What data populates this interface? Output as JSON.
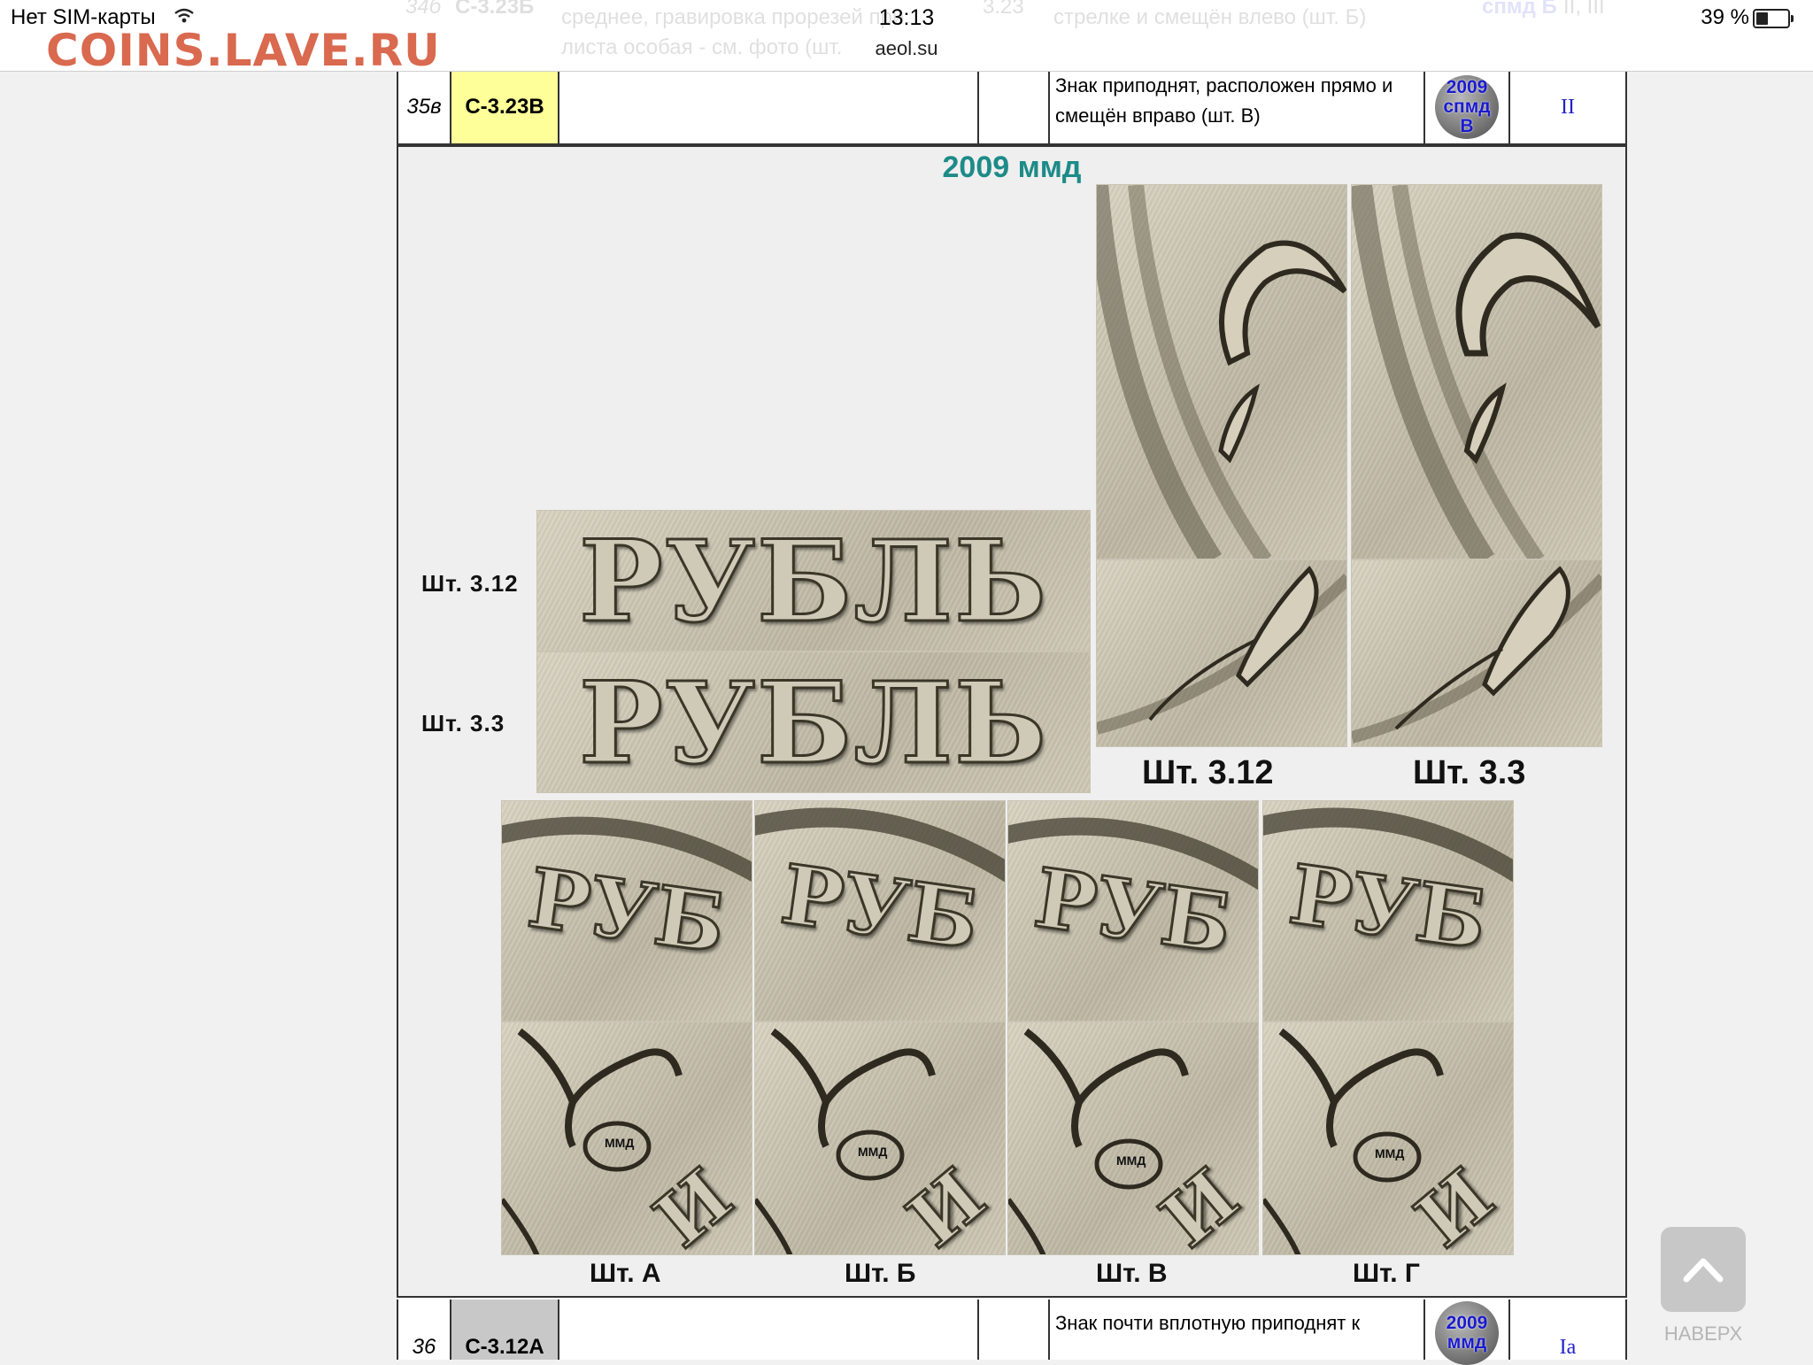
{
  "status_bar": {
    "carrier": "Нет SIM-карты",
    "time": "13:13",
    "url": "aeol.su",
    "battery": "39 %",
    "battery_level": 0.39
  },
  "watermark": "COINS.LAVE.RU",
  "faded_row": {
    "num": "34б",
    "code": "С-3.23Б",
    "desc1": "среднее, гравировка прорезей при",
    "desc2": "листа особая - см. фото (шт.",
    "code2": "3.23",
    "desc3": "стрелке и смещён влево (шт. Б)",
    "year": "спмд Б",
    "grade": "II, III"
  },
  "row_35v": {
    "num": "35в",
    "code": "С-3.23В",
    "desc": "Знак приподнят, расположен прямо и смещён вправо (шт. В)",
    "year_top": "2009",
    "year_mid": "спмд",
    "year_bottom": "В",
    "grade": "II",
    "code_bg": "#ffff99"
  },
  "section": {
    "title": "2009 ммд",
    "title_color": "#1d8b88",
    "side_label_1": "Шт. 3.12",
    "side_label_2": "Шт. 3.3",
    "word": "РУБЛЬ",
    "word_short": "РУБ",
    "right_label_1": "Шт. 3.12",
    "right_label_2": "Шт. 3.3",
    "bottom_labels": [
      "Шт. А",
      "Шт. Б",
      "Шт. В",
      "Шт. Г"
    ],
    "mint_mark": "ММД",
    "letter_i": "И"
  },
  "row_36": {
    "num": "36",
    "code": "С-3.12А",
    "desc": "Знак почти вплотную приподнят к",
    "year_top": "2009",
    "year_mid": "ммд",
    "grade": "Iа",
    "code_bg": "#c8c8c8"
  },
  "scroll_top": {
    "label": "НАВЕРХ",
    "icon": "chevron-up-icon"
  }
}
